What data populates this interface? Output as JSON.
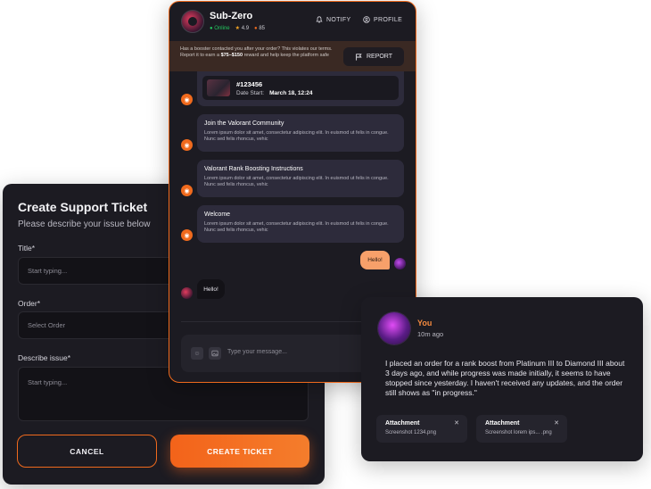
{
  "ticket": {
    "title": "Create Support Ticket",
    "subtitle": "Please describe your issue below",
    "fields": {
      "title_label": "Title*",
      "title_placeholder": "Start typing...",
      "order_label": "Order*",
      "order_placeholder": "Select Order",
      "issue_label": "Describe issue*",
      "issue_placeholder": "Start typing..."
    },
    "cancel_label": "CANCEL",
    "create_label": "CREATE TICKET"
  },
  "chat": {
    "header": {
      "name": "Sub-Zero",
      "status": "Online",
      "rating": "4.9",
      "count": "85",
      "notify_label": "NOTIFY",
      "profile_label": "PROFILE"
    },
    "banner": {
      "text_before": "Has a booster contacted you after your order? This violates our terms. Report it to earn a ",
      "reward": "$75–$150",
      "text_after": " reward and help keep the platform safe",
      "report_label": "REPORT"
    },
    "order": {
      "id": "#123456",
      "date_label": "Date Start:",
      "date_value": "March 18, 12:24"
    },
    "system_messages": [
      {
        "title": "Join the Valorant Community",
        "body": "Lorem ipsum dolor sit amet, consectetur adipiscing elit. In euismod ut felis in congue. Nunc sed felis rhoncus, vehic"
      },
      {
        "title": "Valorant Rank Boosting Instructions",
        "body": "Lorem ipsum dolor sit amet, consectetur adipiscing elit. In euismod ut felis in congue. Nunc sed felis rhoncus, vehic"
      },
      {
        "title": "Welcome",
        "body": "Lorem ipsum dolor sit amet, consectetur adipiscing elit. In euismod ut felis in congue. Nunc sed felis rhoncus, vehic"
      }
    ],
    "my_message": "Hello!",
    "their_message": "Hello!",
    "composer_placeholder": "Type your message..."
  },
  "detail": {
    "name": "You",
    "time": "10m ago",
    "text": "I placed an order for a rank boost from Platinum III to Diamond III about 3 days ago, and while progress was made initially, it seems to have stopped since yesterday. I haven't received any updates, and the order still shows as \"in progress.\"",
    "attachments": [
      {
        "title": "Attachment",
        "file": "Screenshot 1234.png"
      },
      {
        "title": "Attachment",
        "file": "Screenshot lorem ips... .png"
      }
    ]
  },
  "colors": {
    "accent": "#f06a1d",
    "panel": "#1c1b22",
    "card": "#2d2b3b",
    "online": "#23c55e"
  }
}
